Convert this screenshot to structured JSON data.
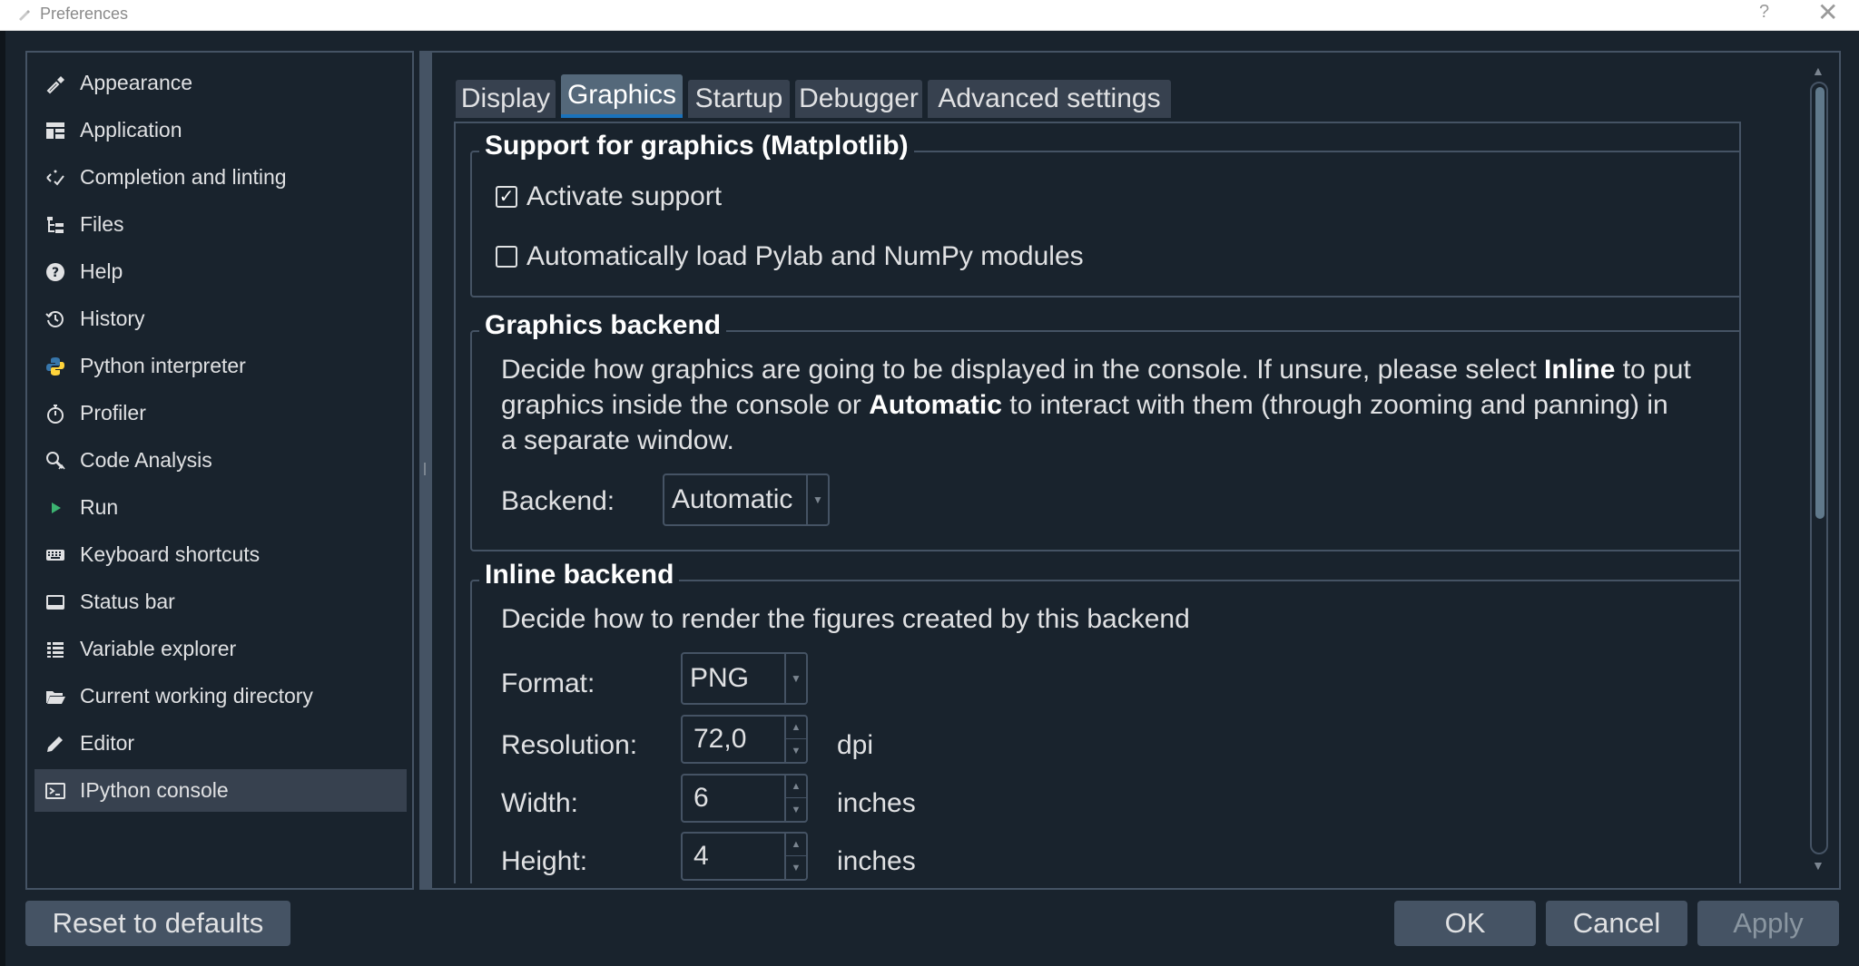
{
  "window": {
    "title": "Preferences",
    "help_glyph": "?",
    "close_glyph": "✕"
  },
  "sidebar": {
    "items": [
      {
        "label": "Appearance",
        "icon": "paintbrush-icon"
      },
      {
        "label": "Application",
        "icon": "layout-icon"
      },
      {
        "label": "Completion and linting",
        "icon": "completion-icon"
      },
      {
        "label": "Files",
        "icon": "files-tree-icon"
      },
      {
        "label": "Help",
        "icon": "help-icon"
      },
      {
        "label": "History",
        "icon": "history-icon"
      },
      {
        "label": "Python interpreter",
        "icon": "python-logo-icon"
      },
      {
        "label": "Profiler",
        "icon": "stopwatch-icon"
      },
      {
        "label": "Code Analysis",
        "icon": "code-analysis-icon"
      },
      {
        "label": "Run",
        "icon": "play-icon"
      },
      {
        "label": "Keyboard shortcuts",
        "icon": "keyboard-icon"
      },
      {
        "label": "Status bar",
        "icon": "status-bar-icon"
      },
      {
        "label": "Variable explorer",
        "icon": "table-icon"
      },
      {
        "label": "Current working directory",
        "icon": "folder-open-icon"
      },
      {
        "label": "Editor",
        "icon": "pencil-icon"
      },
      {
        "label": "IPython console",
        "icon": "console-icon",
        "selected": true
      }
    ]
  },
  "tabs": [
    {
      "label": "Display"
    },
    {
      "label": "Graphics",
      "active": true
    },
    {
      "label": "Startup"
    },
    {
      "label": "Debugger"
    },
    {
      "label": "Advanced settings"
    }
  ],
  "support_group": {
    "title": "Support for graphics (Matplotlib)",
    "activate_label": "Activate support",
    "activate_checked": true,
    "pylab_label": "Automatically load Pylab and NumPy modules",
    "pylab_checked": false
  },
  "backend_group": {
    "title": "Graphics backend",
    "desc_1": "Decide how graphics are going to be displayed in the console. If unsure, please select ",
    "desc_bold_1": "Inline",
    "desc_2": " to put",
    "desc_3": "graphics inside the console or ",
    "desc_bold_2": "Automatic",
    "desc_4": " to interact with them (through zooming and panning) in",
    "desc_5": "a separate window.",
    "backend_label": "Backend:",
    "backend_value": "Automatic"
  },
  "inline_group": {
    "title": "Inline backend",
    "desc": "Decide how to render the figures created by this backend",
    "format_label": "Format:",
    "format_value": "PNG",
    "resolution_label": "Resolution:",
    "resolution_value": "72,0",
    "resolution_unit": "dpi",
    "width_label": "Width:",
    "width_value": "6",
    "width_unit": "inches",
    "height_label": "Height:",
    "height_value": "4",
    "height_unit": "inches"
  },
  "buttons": {
    "reset": "Reset to defaults",
    "ok": "OK",
    "cancel": "Cancel",
    "apply": "Apply"
  },
  "colors": {
    "background": "#19232d",
    "border": "#455364",
    "selected": "#37414f",
    "active_tab": "#54687a",
    "accent": "#1a72bb"
  }
}
